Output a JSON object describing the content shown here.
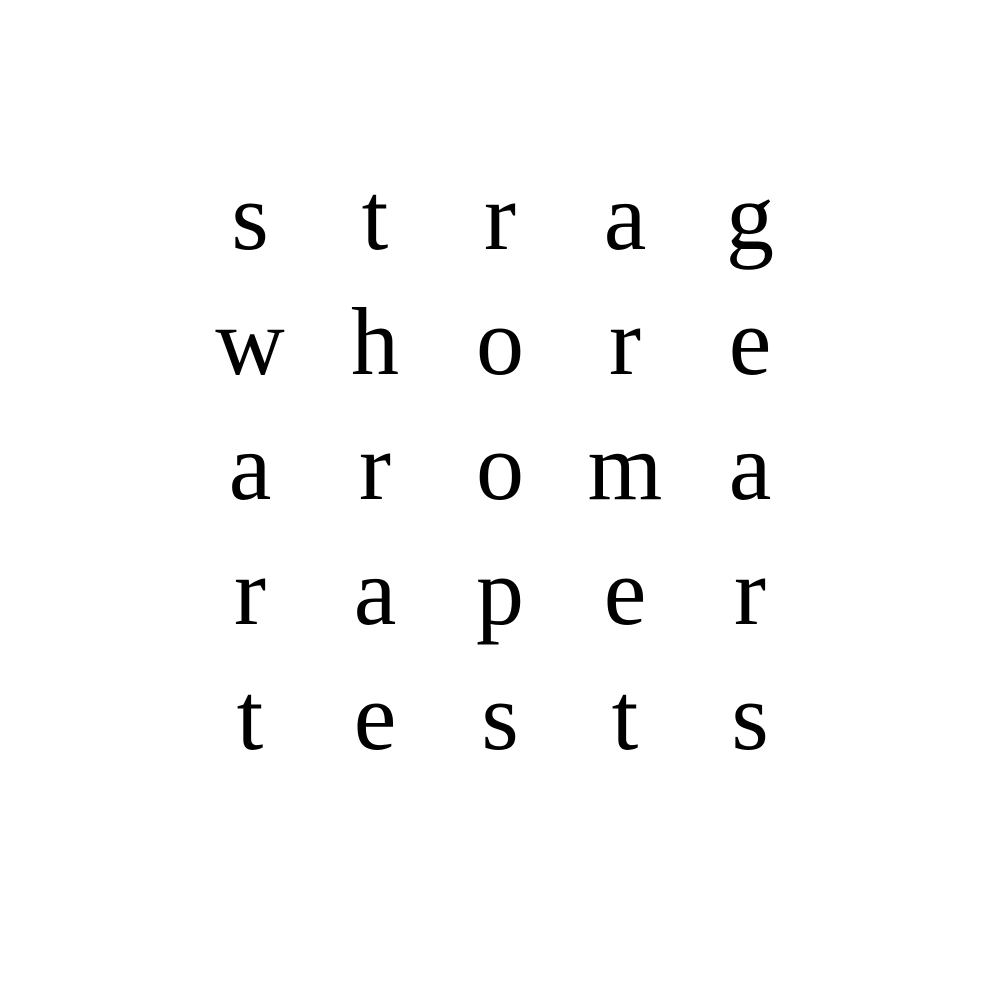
{
  "text_color": "#000000",
  "background": "#ffffff",
  "rows": [
    {
      "word": "strag",
      "letters": [
        "s",
        "t",
        "r",
        "a",
        "g"
      ]
    },
    {
      "word": "whore",
      "letters": [
        "w",
        "h",
        "o",
        "r",
        "e"
      ]
    },
    {
      "word": "aroma",
      "letters": [
        "a",
        "r",
        "o",
        "m",
        "a"
      ]
    },
    {
      "word": "raper",
      "letters": [
        "r",
        "a",
        "p",
        "e",
        "r"
      ]
    },
    {
      "word": "tests",
      "letters": [
        "t",
        "e",
        "s",
        "t",
        "s"
      ]
    }
  ]
}
